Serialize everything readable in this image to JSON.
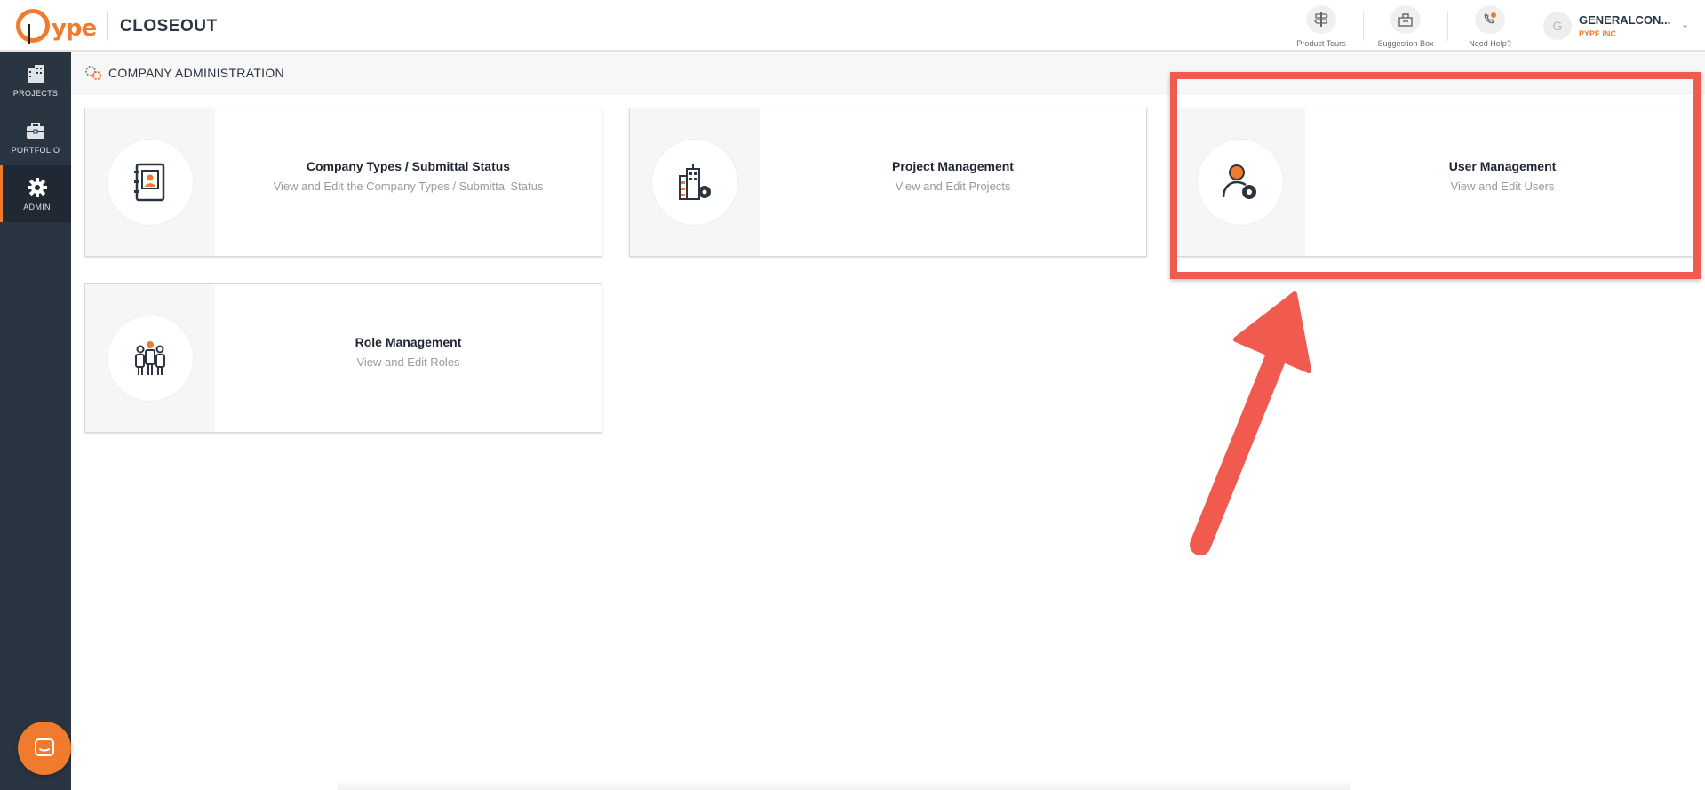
{
  "header": {
    "logo_text": "ype",
    "app_title": "CLOSEOUT",
    "actions": [
      {
        "label": "Product Tours",
        "icon": "signpost-icon"
      },
      {
        "label": "Suggestion Box",
        "icon": "suggestion-box-icon"
      },
      {
        "label": "Need Help?",
        "icon": "phone-help-icon"
      }
    ],
    "user": {
      "initial": "G",
      "name": "GENERALCON...",
      "company": "PYPE INC"
    }
  },
  "sidebar": {
    "items": [
      {
        "label": "PROJECTS",
        "icon": "building-icon"
      },
      {
        "label": "PORTFOLIO",
        "icon": "briefcase-icon"
      },
      {
        "label": "ADMIN",
        "icon": "gear-icon"
      }
    ]
  },
  "page": {
    "title": "COMPANY ADMINISTRATION"
  },
  "cards": [
    {
      "title": "Company Types / Submittal Status",
      "desc": "View and Edit the Company Types / Submittal Status",
      "icon": "contact-book-icon"
    },
    {
      "title": "Project Management",
      "desc": "View and Edit Projects",
      "icon": "building-gear-icon"
    },
    {
      "title": "User Management",
      "desc": "View and Edit Users",
      "icon": "user-gear-icon"
    },
    {
      "title": "Role Management",
      "desc": "View and Edit Roles",
      "icon": "group-icon"
    }
  ],
  "colors": {
    "accent": "#f07a2e",
    "sidebar": "#2a3542",
    "annotation": "#f05a4f"
  }
}
